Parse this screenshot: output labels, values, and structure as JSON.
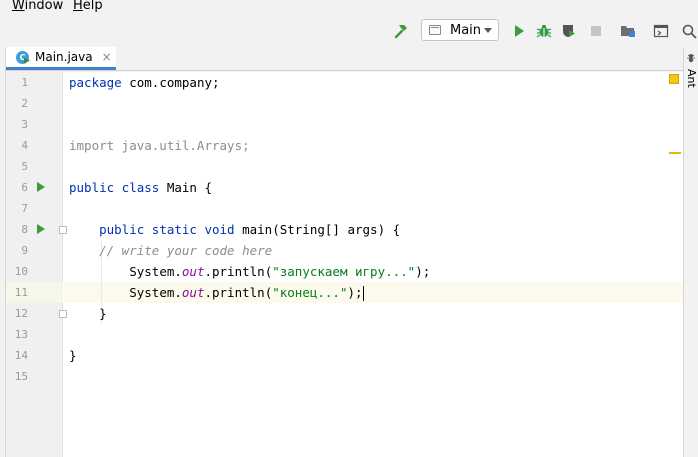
{
  "menu": {
    "window": {
      "mnemonic": "W",
      "rest": "indow"
    },
    "help": {
      "mnemonic": "H",
      "rest": "elp"
    }
  },
  "toolbar": {
    "run_config_label": "Main",
    "icons": [
      "build-hammer-icon",
      "run-icon",
      "debug-icon",
      "coverage-icon",
      "stop-icon",
      "project-structure-icon",
      "layout-icon",
      "search-icon"
    ]
  },
  "tabs": [
    {
      "label": "Main.java",
      "icon_letter": "C",
      "close": "×"
    }
  ],
  "right_panel": {
    "label": "Ant"
  },
  "editor": {
    "line_numbers": [
      "1",
      "2",
      "3",
      "4",
      "5",
      "6",
      "7",
      "8",
      "9",
      "10",
      "11",
      "12",
      "13",
      "14",
      "15"
    ],
    "lines": {
      "l1": {
        "kw": "package",
        "rest": " com.company;"
      },
      "l4": {
        "text": "import java.util.Arrays;"
      },
      "l6": {
        "kw": "public class",
        "rest": " Main {"
      },
      "l8": {
        "indent": "    ",
        "kw": "public static void",
        "rest": " main(String[] args) {"
      },
      "l9": {
        "indent": "    ",
        "comment": "// write your code here"
      },
      "l10": {
        "indent": "        ",
        "pre": "System.",
        "field": "out",
        "mid": ".println(",
        "str": "\"запускаем игру...\"",
        "end": ");"
      },
      "l11": {
        "indent": "        ",
        "pre": "System.",
        "field": "out",
        "mid": ".println(",
        "str": "\"конец...\"",
        "end": ");"
      },
      "l12": {
        "text": "    }"
      },
      "l14": {
        "text": "}"
      }
    }
  },
  "colors": {
    "keyword": "#0033b3",
    "string": "#067d17",
    "field": "#871094",
    "comment": "#8c8c8c",
    "accent": "#4083c9"
  }
}
